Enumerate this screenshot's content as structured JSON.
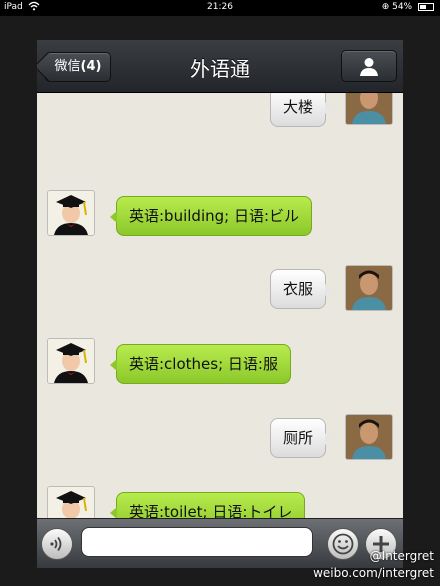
{
  "status_bar": {
    "device": "iPad",
    "time": "21:26",
    "battery": "54%",
    "battery_level": 0.54
  },
  "navbar": {
    "back_label": "微信",
    "back_count": "(4)",
    "title": "外语通"
  },
  "messages": [
    {
      "side": "right",
      "text": "大楼"
    },
    {
      "side": "left",
      "text": "英语:building;  日语:ビル"
    },
    {
      "side": "right",
      "text": "衣服"
    },
    {
      "side": "left",
      "text": "英语:clothes;  日语:服"
    },
    {
      "side": "right",
      "text": "厕所"
    },
    {
      "side": "left",
      "text": "英语:toilet;  日语:トイレ"
    }
  ],
  "input_bar": {
    "placeholder": "",
    "value": ""
  },
  "watermark": {
    "handle": "@Intergret",
    "url": "weibo.com/intergret"
  },
  "colors": {
    "green_bubble": "#a8dc3c",
    "white_bubble": "#f2f2f2",
    "chat_background": "#eae7df"
  }
}
